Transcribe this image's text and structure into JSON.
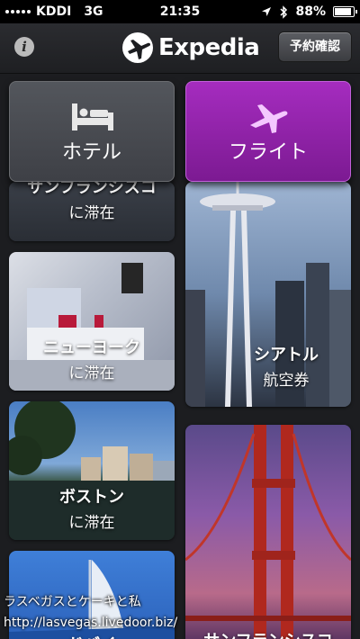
{
  "status_bar": {
    "carrier": "KDDI",
    "network": "3G",
    "time": "21:35",
    "battery": "88%",
    "battery_level": 0.88
  },
  "header": {
    "logo_text": "Expedia",
    "confirm_button": "予約確認"
  },
  "categories": {
    "hotel": "ホテル",
    "flight": "フライト"
  },
  "tiles": {
    "sf_partial": {
      "title": "サンフランシスコ",
      "sub": "に滞在"
    },
    "new_york": {
      "title": "ニューヨーク",
      "sub": "に滞在"
    },
    "seattle": {
      "title": "シアトル",
      "sub": "航空券"
    },
    "boston": {
      "title": "ボストン",
      "sub": "に滞在"
    },
    "dubai": {
      "title": "ドバイ"
    },
    "sf_bottom": {
      "title": "サンフランシスコ"
    }
  },
  "watermark": {
    "line1": "ラスベガスとケーキと私",
    "line2": "http://lasvegas.livedoor.biz/"
  }
}
